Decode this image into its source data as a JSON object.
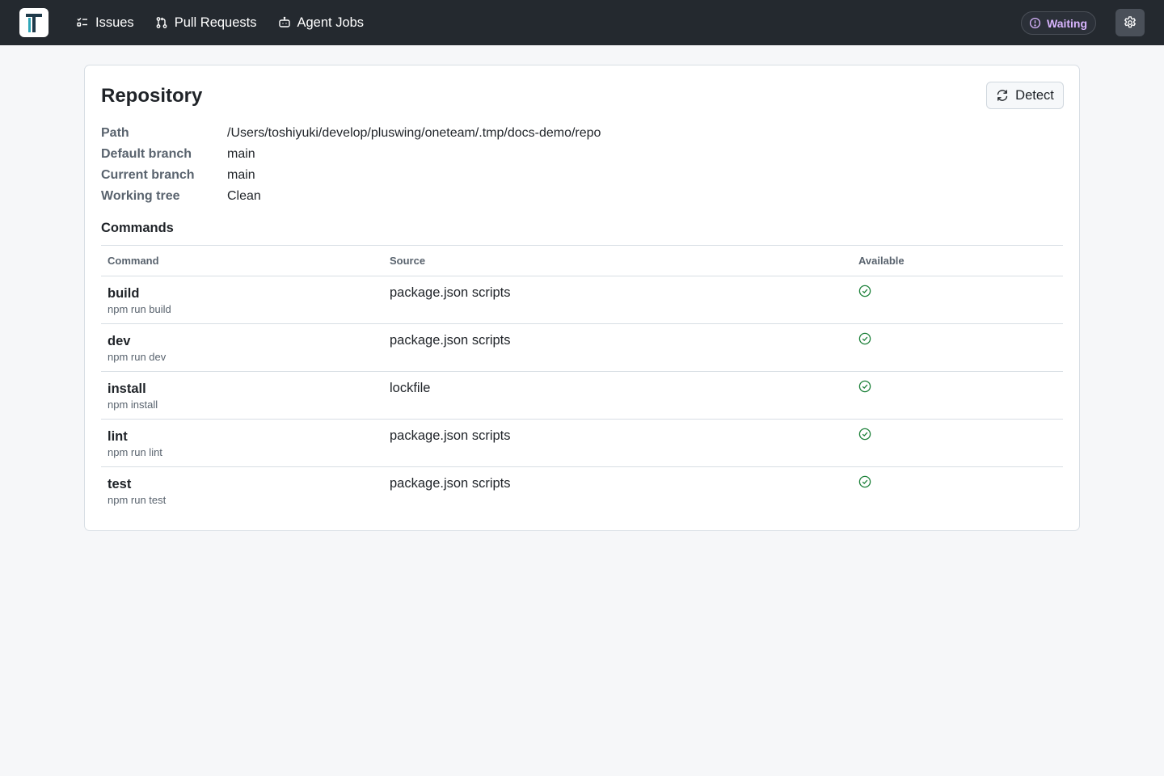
{
  "app": {
    "logo_text": "T",
    "nav": [
      {
        "label": "Issues",
        "icon": "tasklist-icon"
      },
      {
        "label": "Pull Requests",
        "icon": "git-pull-request-icon"
      },
      {
        "label": "Agent Jobs",
        "icon": "robot-icon"
      }
    ],
    "status": {
      "label": "Waiting",
      "icon": "info-circle-icon",
      "color": "#d8b4fe"
    },
    "settings_icon": "gear-icon"
  },
  "repository": {
    "title": "Repository",
    "detect_label": "Detect",
    "detect_icon": "refresh-icon",
    "properties": [
      {
        "key": "Path",
        "value": "/Users/toshiyuki/develop/pluswing/oneteam/.tmp/docs-demo/repo"
      },
      {
        "key": "Default branch",
        "value": "main"
      },
      {
        "key": "Current branch",
        "value": "main"
      },
      {
        "key": "Working tree",
        "value": "Clean"
      }
    ],
    "commands_title": "Commands",
    "columns": [
      "Command",
      "Source",
      "Available"
    ],
    "commands": [
      {
        "name": "build",
        "cmd": "npm run build",
        "source": "package.json scripts",
        "available": true
      },
      {
        "name": "dev",
        "cmd": "npm run dev",
        "source": "package.json scripts",
        "available": true
      },
      {
        "name": "install",
        "cmd": "npm install",
        "source": "lockfile",
        "available": true
      },
      {
        "name": "lint",
        "cmd": "npm run lint",
        "source": "package.json scripts",
        "available": true
      },
      {
        "name": "test",
        "cmd": "npm run test",
        "source": "package.json scripts",
        "available": true
      }
    ],
    "available_color": "#1a7f37"
  }
}
